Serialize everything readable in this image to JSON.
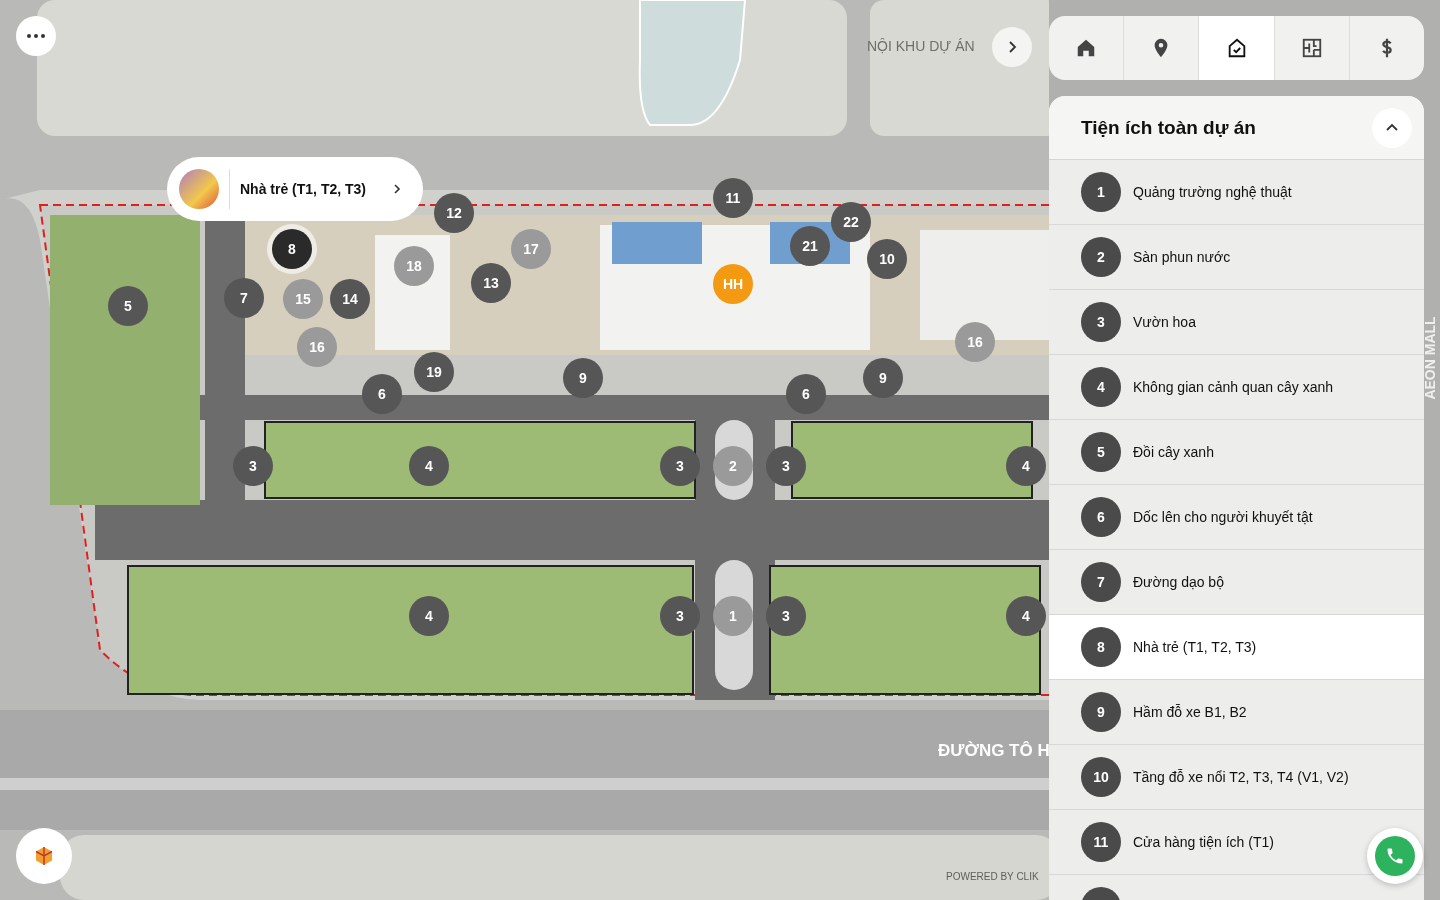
{
  "map": {
    "area_label": "NỘI KHU DỰ ÁN",
    "street_label": "ĐƯỜNG TÔ H",
    "building_label": "AEON MALL",
    "credit": "POWERED BY CLIK",
    "callout": {
      "title": "Nhà trẻ (T1, T2, T3)"
    },
    "markers": [
      {
        "label": "12",
        "kind": "dark",
        "selected": false
      },
      {
        "label": "11",
        "kind": "dark",
        "selected": false
      },
      {
        "label": "22",
        "kind": "dark",
        "selected": false
      },
      {
        "label": "8",
        "kind": "dark",
        "selected": true
      },
      {
        "label": "17",
        "kind": "light",
        "selected": false
      },
      {
        "label": "21",
        "kind": "dark",
        "selected": false
      },
      {
        "label": "10",
        "kind": "dark",
        "selected": false
      },
      {
        "label": "18",
        "kind": "light",
        "selected": false
      },
      {
        "label": "13",
        "kind": "dark",
        "selected": false
      },
      {
        "label": "HH",
        "kind": "accent",
        "selected": false
      },
      {
        "label": "7",
        "kind": "dark",
        "selected": false
      },
      {
        "label": "15",
        "kind": "light",
        "selected": false
      },
      {
        "label": "14",
        "kind": "dark",
        "selected": false
      },
      {
        "label": "5",
        "kind": "dark",
        "selected": false
      },
      {
        "label": "16",
        "kind": "light",
        "selected": false
      },
      {
        "label": "16",
        "kind": "light",
        "selected": false
      },
      {
        "label": "19",
        "kind": "dark",
        "selected": false
      },
      {
        "label": "6",
        "kind": "dark",
        "selected": false
      },
      {
        "label": "9",
        "kind": "dark",
        "selected": false
      },
      {
        "label": "6",
        "kind": "dark",
        "selected": false
      },
      {
        "label": "9",
        "kind": "dark",
        "selected": false
      },
      {
        "label": "3",
        "kind": "dark",
        "selected": false
      },
      {
        "label": "4",
        "kind": "dark",
        "selected": false
      },
      {
        "label": "3",
        "kind": "dark",
        "selected": false
      },
      {
        "label": "2",
        "kind": "light",
        "selected": false
      },
      {
        "label": "3",
        "kind": "dark",
        "selected": false
      },
      {
        "label": "4",
        "kind": "dark",
        "selected": false
      },
      {
        "label": "4",
        "kind": "dark",
        "selected": false
      },
      {
        "label": "3",
        "kind": "dark",
        "selected": false
      },
      {
        "label": "1",
        "kind": "light",
        "selected": false
      },
      {
        "label": "3",
        "kind": "dark",
        "selected": false
      },
      {
        "label": "4",
        "kind": "dark",
        "selected": false
      }
    ]
  },
  "nav_tabs": [
    {
      "selected": false
    },
    {
      "selected": false
    },
    {
      "selected": true
    },
    {
      "selected": false
    },
    {
      "selected": false
    }
  ],
  "amenities_panel": {
    "title": "Tiện ích toàn dự án",
    "expanded": true,
    "items": [
      {
        "number": "1",
        "name": "Quảng trường nghệ thuật",
        "selected": false
      },
      {
        "number": "2",
        "name": "Sàn phun nước",
        "selected": false
      },
      {
        "number": "3",
        "name": "Vườn hoa",
        "selected": false
      },
      {
        "number": "4",
        "name": "Không gian cảnh quan cây xanh",
        "selected": false
      },
      {
        "number": "5",
        "name": "Đồi cây xanh",
        "selected": false
      },
      {
        "number": "6",
        "name": "Dốc lên cho người khuyết tật",
        "selected": false
      },
      {
        "number": "7",
        "name": "Đường dạo bộ",
        "selected": false
      },
      {
        "number": "8",
        "name": "Nhà trẻ (T1, T2, T3)",
        "selected": true
      },
      {
        "number": "9",
        "name": "Hầm đỗ xe B1, B2",
        "selected": false
      },
      {
        "number": "10",
        "name": "Tầng đỗ xe nổi T2, T3, T4 (V1, V2)",
        "selected": false
      },
      {
        "number": "11",
        "name": "Cửa hàng tiện ích (T1)",
        "selected": false
      }
    ]
  }
}
